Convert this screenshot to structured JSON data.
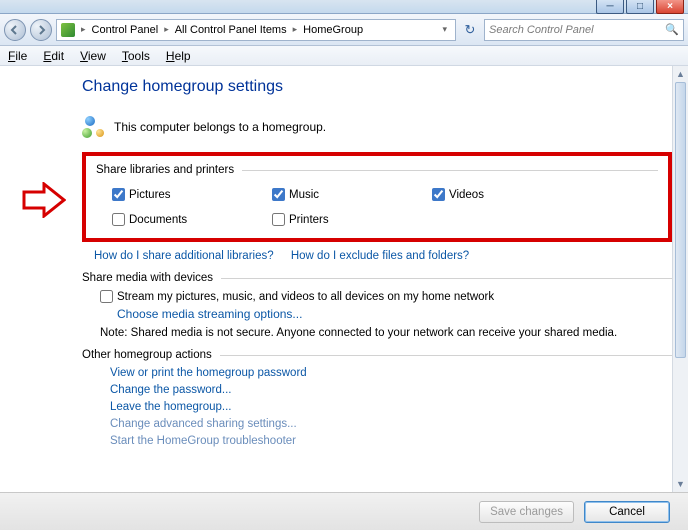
{
  "window": {
    "min": "─",
    "max": "□",
    "close": "×"
  },
  "breadcrumb": {
    "items": [
      "Control Panel",
      "All Control Panel Items",
      "HomeGroup"
    ]
  },
  "search": {
    "placeholder": "Search Control Panel"
  },
  "menu": {
    "file": "File",
    "edit": "Edit",
    "view": "View",
    "tools": "Tools",
    "help": "Help"
  },
  "page": {
    "title": "Change homegroup settings",
    "belongs": "This computer belongs to a homegroup."
  },
  "share": {
    "legend": "Share libraries and printers",
    "pictures": "Pictures",
    "music": "Music",
    "videos": "Videos",
    "documents": "Documents",
    "printers": "Printers",
    "checked": {
      "pictures": true,
      "music": true,
      "videos": true,
      "documents": false,
      "printers": false
    }
  },
  "help_links": {
    "share_additional": "How do I share additional libraries?",
    "exclude": "How do I exclude files and folders?"
  },
  "media": {
    "legend": "Share media with devices",
    "stream": "Stream my pictures, music, and videos to all devices on my home network",
    "choose": "Choose media streaming options...",
    "note": "Note: Shared media is not secure. Anyone connected to your network can receive your shared media."
  },
  "actions": {
    "legend": "Other homegroup actions",
    "view_pw": "View or print the homegroup password",
    "change_pw": "Change the password...",
    "leave": "Leave the homegroup...",
    "advanced": "Change advanced sharing settings...",
    "trouble": "Start the HomeGroup troubleshooter"
  },
  "footer": {
    "save": "Save changes",
    "cancel": "Cancel"
  }
}
